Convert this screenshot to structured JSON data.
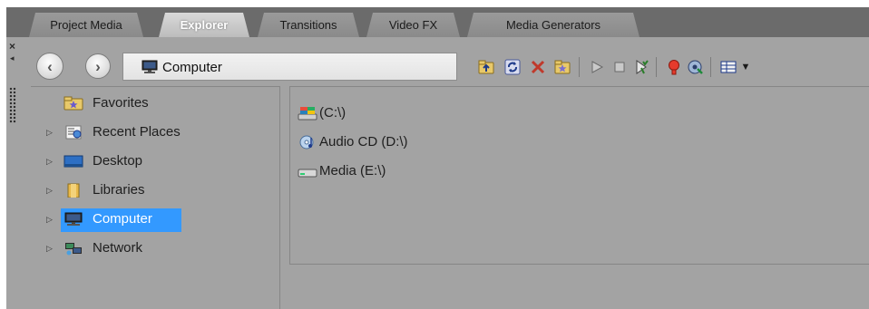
{
  "tabs": [
    {
      "label": "Project Media",
      "active": false
    },
    {
      "label": "Explorer",
      "active": true
    },
    {
      "label": "Transitions",
      "active": false
    },
    {
      "label": "Video FX",
      "active": false
    },
    {
      "label": "Media Generators",
      "active": false
    }
  ],
  "window_controls": {
    "close_glyph": "×",
    "pin_glyph": "◂"
  },
  "address": {
    "path": "Computer",
    "icon": "computer-icon"
  },
  "toolbar": {
    "icons": [
      "up-folder-icon",
      "refresh-icon",
      "delete-icon",
      "add-favorite-icon",
      "play-icon",
      "stop-icon",
      "auto-preview-icon",
      "record-icon",
      "extract-audio-icon",
      "views-icon"
    ],
    "dropdown_glyph": "▼"
  },
  "tree": {
    "items": [
      {
        "label": "Favorites",
        "icon": "favorites-icon",
        "expandable": false,
        "selected": false
      },
      {
        "label": "Recent Places",
        "icon": "recent-places-icon",
        "expandable": true,
        "selected": false
      },
      {
        "label": "Desktop",
        "icon": "desktop-icon",
        "expandable": true,
        "selected": false
      },
      {
        "label": "Libraries",
        "icon": "libraries-icon",
        "expandable": true,
        "selected": false
      },
      {
        "label": "Computer",
        "icon": "computer-icon",
        "expandable": true,
        "selected": true
      },
      {
        "label": "Network",
        "icon": "network-icon",
        "expandable": true,
        "selected": false
      }
    ]
  },
  "files": {
    "items": [
      {
        "label": "(C:\\)",
        "icon": "system-drive-icon"
      },
      {
        "label": "Audio CD (D:\\)",
        "icon": "audio-cd-icon"
      },
      {
        "label": "Media (E:\\)",
        "icon": "hard-drive-icon"
      }
    ]
  },
  "colors": {
    "panel_bg": "#a3a3a3",
    "tab_strip": "#6b6b6b",
    "selection": "#3399ff"
  }
}
